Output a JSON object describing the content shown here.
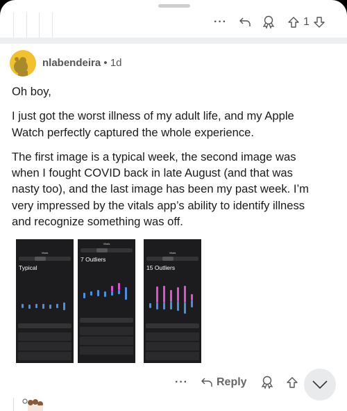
{
  "parent_actions": {
    "more_icon": "more-icon",
    "reply_icon": "reply-icon",
    "award_icon": "award-icon",
    "vote_count": "1"
  },
  "comment": {
    "username": "nlabendeira",
    "separator": "•",
    "age": "1d",
    "avatar_color": "#f2c12e",
    "paragraphs": [
      [
        "Oh boy,"
      ],
      [
        "I just got the worst illness of my adult life, and my Apple",
        "Watch perfectly captured the whole experience."
      ],
      [
        "The first image is a typical week, the second image was",
        "when I fought COVID back in late August (and that was",
        "nasty too), and the last image has been my past week. I’m",
        "very impressed by the vitals app’s ability to identify illness",
        "and recognize something was off."
      ]
    ],
    "images": [
      {
        "title": "Typical",
        "nav": "Vitals"
      },
      {
        "title": "7 Outliers",
        "nav": "Vitals"
      },
      {
        "title": "15 Outliers",
        "nav": "Vitals"
      }
    ],
    "actions": {
      "reply_label": "Reply"
    }
  },
  "colors": {
    "typical": "#4a90e2",
    "outlier": "#e34fd0"
  }
}
